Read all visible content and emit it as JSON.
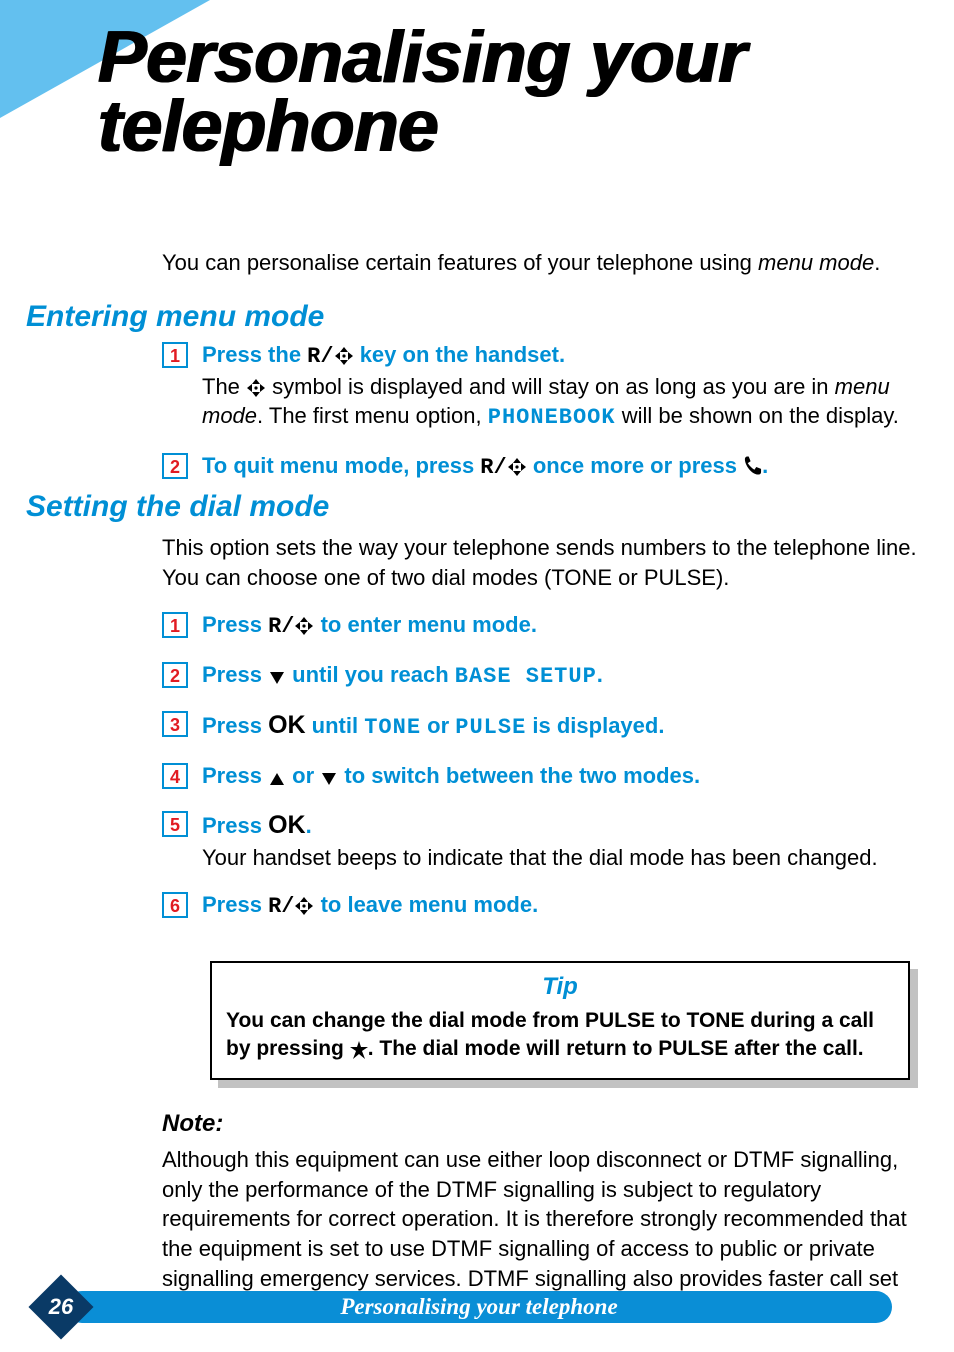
{
  "title": "Personalising your telephone",
  "intro": {
    "pre": "You can personalise certain features of your telephone using ",
    "em": "menu mode",
    "post": "."
  },
  "section1": {
    "heading": "Entering menu mode",
    "steps": [
      {
        "num": "1",
        "title_pre": "Press the ",
        "title_key": "R/",
        "title_post": " key on the handset.",
        "desc_pre": "The ",
        "desc_mid": " symbol is displayed and will stay on as long as you are in ",
        "desc_em": "menu mode",
        "desc_post1": ".  The first menu option, ",
        "desc_opt": "PHONEBOOK",
        "desc_post2": " will be shown on the display."
      },
      {
        "num": "2",
        "title_pre": "To quit menu mode, press ",
        "title_key": "R/",
        "title_mid": " once more or press ",
        "title_end": "."
      }
    ]
  },
  "section2": {
    "heading": "Setting the dial mode",
    "body": "This option sets the way your telephone sends numbers to the telephone line. You can choose one of two dial modes (TONE or PULSE).",
    "steps": [
      {
        "num": "1",
        "t1": "Press ",
        "key": "R/",
        "t2": " to enter menu mode."
      },
      {
        "num": "2",
        "t1": "Press ",
        "t2": " until you reach ",
        "opt": "BASE SETUP",
        "t3": "."
      },
      {
        "num": "3",
        "t1": "Press ",
        "ok": "OK",
        "t2": " until ",
        "opt1": "TONE",
        "t3": " or ",
        "opt2": "PULSE",
        "t4": " is displayed."
      },
      {
        "num": "4",
        "t1": "Press ",
        "t2": " or ",
        "t3": " to switch between the two modes."
      },
      {
        "num": "5",
        "t1": "Press ",
        "ok": "OK",
        "t2": ".",
        "desc": "Your handset beeps to indicate that the dial mode has been changed."
      },
      {
        "num": "6",
        "t1": "Press ",
        "key": "R/",
        "t2": " to leave menu mode."
      }
    ]
  },
  "tip": {
    "title": "Tip",
    "t1": "You can change the dial mode from PULSE to TONE during a call by pressing ",
    "t2": ".  The dial mode will return to PULSE after the call."
  },
  "note": {
    "heading": "Note:",
    "body": "Although this equipment can use either loop disconnect or DTMF signalling, only the performance of the DTMF signalling is subject to regulatory requirements for correct operation.  It is therefore strongly recommended that the equipment is set to use DTMF signalling of access to public or private signalling emergency services.  DTMF signalling also provides faster call set up."
  },
  "footer": {
    "page": "26",
    "label": "Personalising your telephone"
  }
}
